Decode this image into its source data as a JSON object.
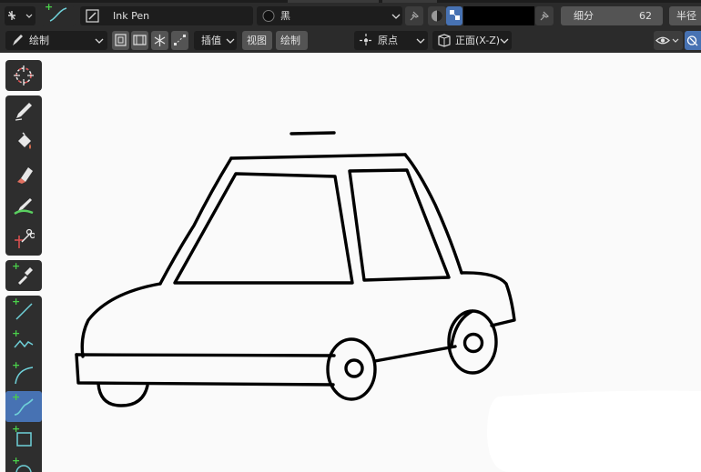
{
  "header": {
    "brush_name": "Ink Pen",
    "material_name": "黑",
    "subdivide_label": "细分",
    "subdivide_value": "62",
    "radius_label": "半径"
  },
  "toolbar": {
    "mode_label": "绘制",
    "interpolate_label": "插值",
    "view_label": "视图",
    "draw_label": "绘制",
    "origin_label": "原点",
    "orientation_label": "正面(X-Z)"
  },
  "colors": {
    "panel": "#2b2b2b",
    "field": "#1d1d1d",
    "button": "#545454",
    "active": "#4772b3",
    "stroke": "#000000",
    "canvas": "#fafafa"
  },
  "tools": [
    {
      "name": "cursor-icon"
    },
    {
      "name": "draw-icon"
    },
    {
      "name": "fill-icon"
    },
    {
      "name": "erase-icon"
    },
    {
      "name": "tint-icon"
    },
    {
      "name": "cutter-icon"
    },
    {
      "name": "eyedropper-icon"
    },
    {
      "name": "line-icon"
    },
    {
      "name": "polyline-icon"
    },
    {
      "name": "arc-icon"
    },
    {
      "name": "curve-icon"
    },
    {
      "name": "box-icon"
    },
    {
      "name": "circle-icon"
    }
  ]
}
